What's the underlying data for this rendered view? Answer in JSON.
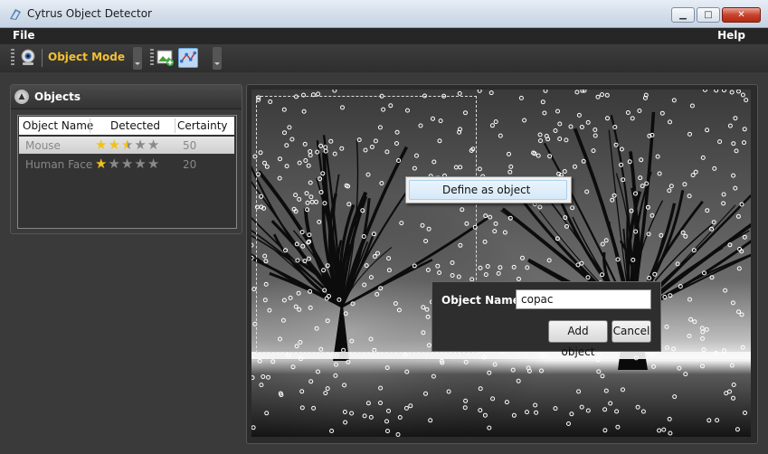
{
  "window": {
    "title": "Cytrus Object Detector",
    "icon": "app-logo-icon"
  },
  "menu": {
    "file": "File",
    "help": "Help"
  },
  "toolbar": {
    "mode_label": "Object Mode",
    "icons": [
      "webcam-icon",
      "add-image-icon",
      "object-detect-icon"
    ]
  },
  "panel": {
    "title": "Objects",
    "columns": [
      "Object Name",
      "Detected",
      "Certainty"
    ],
    "rows": [
      {
        "name": "Mouse",
        "stars": 2.5,
        "certainty": "50",
        "selected": true
      },
      {
        "name": "Human Face",
        "stars": 1,
        "certainty": "20",
        "selected": false
      }
    ],
    "max_stars": 5
  },
  "context_menu": {
    "item": "Define as object"
  },
  "dialog": {
    "label": "Object Name:",
    "value": "copac",
    "add_button": "Add object",
    "cancel_button": "Cancel"
  },
  "colors": {
    "accent": "#f2c230",
    "star": "#f0c21b",
    "menubar": "#262626"
  }
}
